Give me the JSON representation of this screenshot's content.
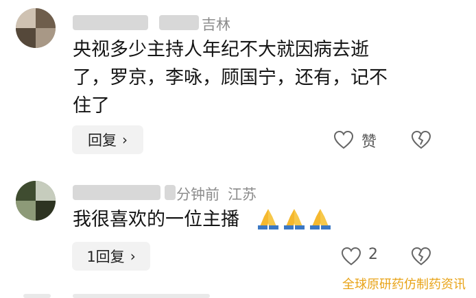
{
  "comments": [
    {
      "location_suffix": "吉林",
      "content": "央视多少主持人年纪不大就因病去逝了，罗京，李咏，顾国宁，还有，记不住了",
      "content_lines": [
        "央视多少主持人年纪不大就因病去逝",
        "了，罗京，李咏，顾国宁，还有，记不",
        "住了"
      ],
      "reply_label": "回复",
      "like_label": "赞"
    },
    {
      "time_partial": "分钟前",
      "location": "江苏",
      "content": "我很喜欢的一位主播",
      "emoji": [
        "🙏",
        "🙏",
        "🙏"
      ],
      "reply_label": "1回复",
      "like_count": "2"
    }
  ],
  "watermark": "全球原研药仿制药资讯",
  "colors": {
    "watermark": "#e8a317",
    "meta": "#8c8c8c",
    "button_bg": "#f2f2f2"
  },
  "icons": [
    "heart-outline-icon",
    "broken-heart-icon",
    "chevron-right-icon",
    "pray-emoji"
  ]
}
